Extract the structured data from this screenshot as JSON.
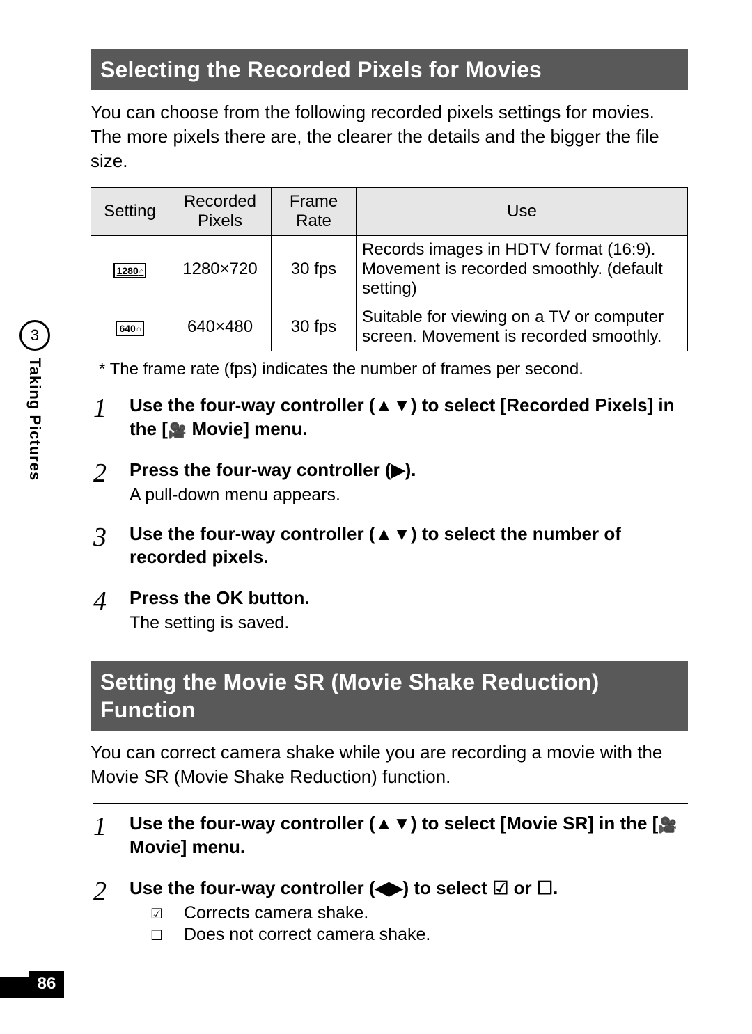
{
  "side": {
    "chapter_num": "3",
    "chapter_label": "Taking Pictures"
  },
  "page_number": "86",
  "section1": {
    "title": "Selecting the Recorded Pixels for Movies",
    "intro": "You can choose from the following recorded pixels settings for movies. The more pixels there are, the clearer the details and the bigger the file size.",
    "table": {
      "headers": {
        "setting": "Setting",
        "pixels": "Recorded Pixels",
        "rate": "Frame Rate",
        "use": "Use"
      },
      "rows": [
        {
          "setting_icon": "1280",
          "pixels": "1280×720",
          "rate": "30 fps",
          "use": "Records images in HDTV format (16:9). Movement is recorded smoothly. (default setting)"
        },
        {
          "setting_icon": "640",
          "pixels": "640×480",
          "rate": "30 fps",
          "use": "Suitable for viewing on a TV or computer screen. Movement is recorded smoothly."
        }
      ]
    },
    "footnote": "*   The frame rate (fps) indicates the number of frames per second.",
    "steps": [
      {
        "n": "1",
        "title_a": "Use the four-way controller (▲▼) to select [Recorded Pixels] in the [",
        "title_b": " Movie] menu."
      },
      {
        "n": "2",
        "title": "Press the four-way controller (▶).",
        "sub": "A pull-down menu appears."
      },
      {
        "n": "3",
        "title": "Use the four-way controller (▲▼) to select the number of recorded pixels."
      },
      {
        "n": "4",
        "title_a": "Press the ",
        "title_b": " button.",
        "ok": "OK",
        "sub": "The setting is saved."
      }
    ]
  },
  "section2": {
    "title": "Setting the Movie SR (Movie Shake Reduction) Function",
    "intro": "You can correct camera shake while you are recording a movie with the Movie SR (Movie Shake Reduction) function.",
    "steps": [
      {
        "n": "1",
        "title_a": "Use the four-way controller (▲▼) to select [Movie SR] in the [",
        "title_b": " Movie] menu."
      },
      {
        "n": "2",
        "title": "Use the four-way controller (◀▶) to select ☑ or ☐.",
        "options": [
          {
            "sym": "☑",
            "text": "Corrects camera shake."
          },
          {
            "sym": "☐",
            "text": "Does not correct camera shake."
          }
        ]
      }
    ]
  }
}
